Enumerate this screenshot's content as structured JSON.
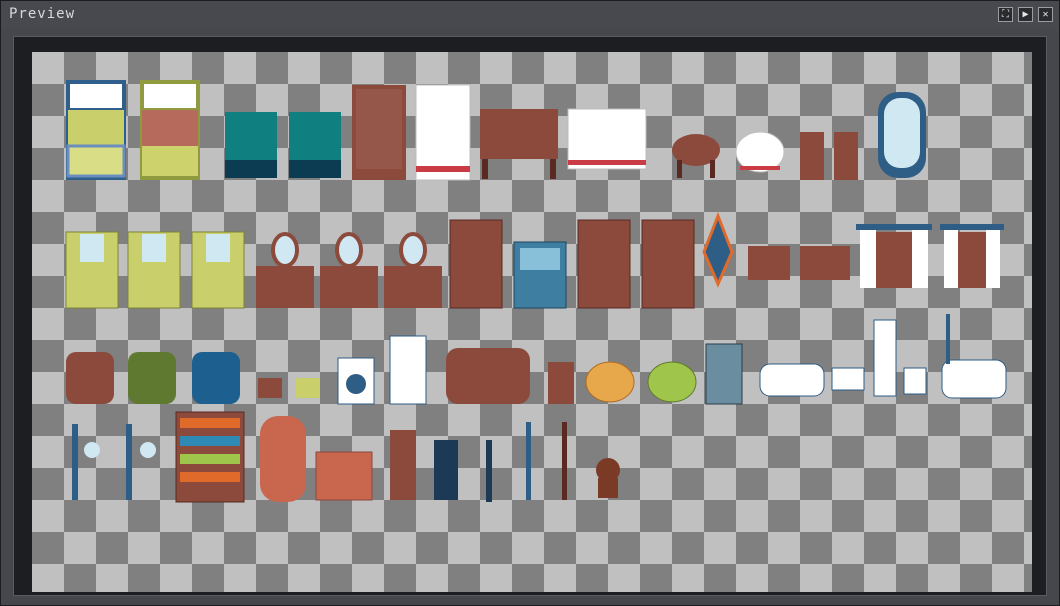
{
  "window": {
    "title": "Preview"
  },
  "titlebar_buttons": [
    {
      "name": "fullscreen-button",
      "glyph": "⛶"
    },
    {
      "name": "play-button",
      "glyph": "▶"
    },
    {
      "name": "close-button",
      "glyph": "✕"
    }
  ],
  "colors": {
    "wood": "#8b4a3c",
    "wood_dark": "#5a2a22",
    "teal": "#0f7f80",
    "olive": "#c9cf6a",
    "blue": "#2e5d85",
    "white": "#ffffff"
  },
  "sprites": [
    "blue-crib-bed",
    "olive-crib-bed",
    "teal-nightstand",
    "teal-desk",
    "brown-wardrobe",
    "white-wardrobe",
    "brown-table",
    "white-table",
    "round-table",
    "round-stool",
    "brown-chair",
    "brown-chair-2",
    "standing-mirror",
    "olive-vanity",
    "olive-vanity-2",
    "olive-vanity-3",
    "brown-vanity",
    "brown-vanity-2",
    "brown-vanity-3",
    "brown-hutch",
    "blue-cabinet",
    "brown-armoire",
    "brown-armoire-open",
    "wall-clock",
    "small-dresser",
    "low-dresser",
    "curtain-window",
    "curtain-window-2",
    "brown-armchair",
    "green-armchair",
    "blue-armchair",
    "small-stool",
    "green-footstool",
    "washing-machine",
    "refrigerator",
    "brown-sofa",
    "small-cabinet",
    "orange-rug",
    "green-rug",
    "stove",
    "bathtub",
    "sink",
    "toilet",
    "bidet",
    "bathtub-shower",
    "floor-lamp",
    "floor-lamp-2",
    "bookshelf",
    "fireplace-tall",
    "brick-fireplace",
    "tall-chair",
    "dark-chair",
    "coat-stand",
    "coat-rack",
    "coat-rack-2",
    "teddy-bear"
  ]
}
